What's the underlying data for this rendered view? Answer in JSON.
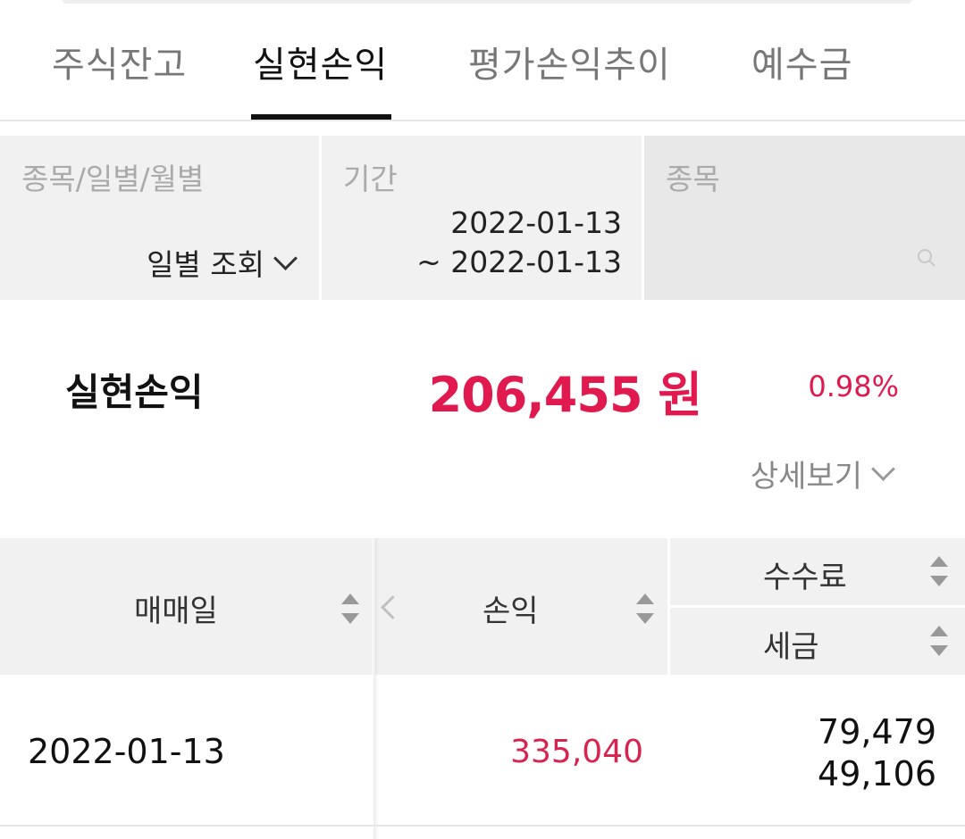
{
  "tabs": [
    {
      "label": "주식잔고"
    },
    {
      "label": "실현손익"
    },
    {
      "label": "평가손익추이"
    },
    {
      "label": "예수금"
    }
  ],
  "filter": {
    "type_label": "종목/일별/월별",
    "type_value": "일별 조회",
    "period_label": "기간",
    "period_start": "2022-01-13",
    "period_end": "~ 2022-01-13",
    "stock_label": "종목"
  },
  "summary": {
    "label": "실현손익",
    "value": "206,455 원",
    "rate": "0.98%",
    "detail_label": "상세보기"
  },
  "table": {
    "headers": {
      "date": "매매일",
      "profit_loss": "손익",
      "fee": "수수료",
      "tax": "세금"
    },
    "rows": [
      {
        "date": "2022-01-13",
        "profit_loss": "335,040",
        "fee": "79,479",
        "tax": "49,106"
      }
    ]
  },
  "colors": {
    "accent_red": "#e01a4f",
    "header_bg": "#f1f1f1",
    "active_tab": "#111111"
  }
}
